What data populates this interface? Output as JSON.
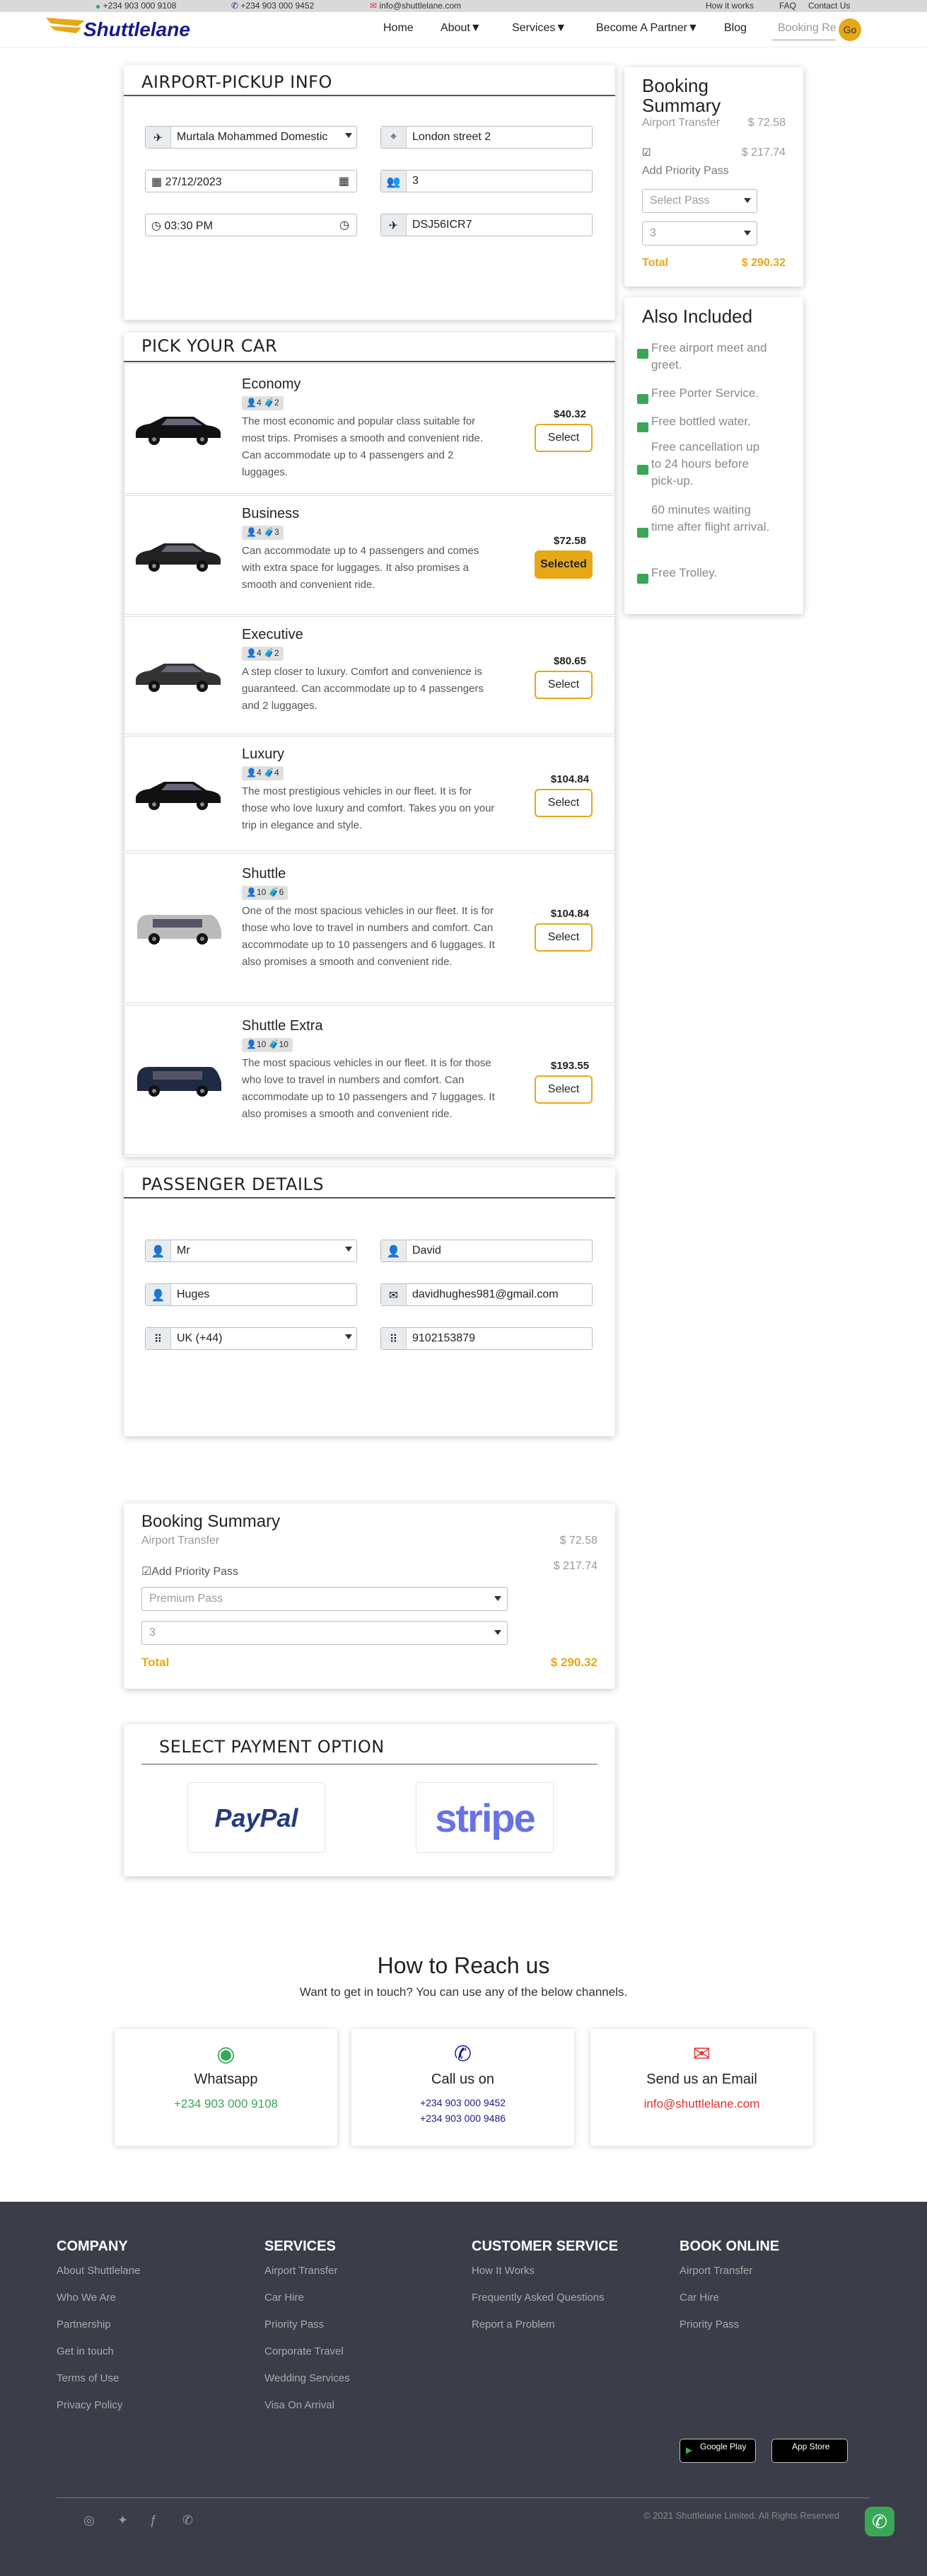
{
  "topbar": {
    "whatsapp": "+234 903 000 9108",
    "phone": "+234 903 000 9452",
    "email": "info@shuttlelane.com",
    "links": [
      "How it works",
      "FAQ",
      "Contact Us"
    ]
  },
  "nav": {
    "logo": "Shuttlelane",
    "items": [
      "Home",
      "About",
      "Services",
      "Become A Partner",
      "Blog"
    ],
    "search_placeholder": "Booking Re",
    "go": "Go"
  },
  "pickup": {
    "title": "AIRPORT-PICKUP INFO",
    "airport": "Murtala Mohammed Domestic",
    "address": "London street 2",
    "date": "27/12/2023",
    "passengers": "3",
    "time": "03:30 PM",
    "flight": "DSJ56ICR7"
  },
  "cars": {
    "title": "PICK YOUR CAR",
    "items": [
      {
        "name": "Economy",
        "pax": "4",
        "lug": "2",
        "desc": "The most economic and popular class suitable for most trips. Promises a smooth and convenient ride. Can accommodate up to 4 passengers and 2 luggages.",
        "price": "$40.32",
        "btn": "Select",
        "selected": false
      },
      {
        "name": "Business",
        "pax": "4",
        "lug": "3",
        "desc": "Can accommodate up to 4 passengers and comes with extra space for luggages. It also promises a smooth and convenient ride.",
        "price": "$72.58",
        "btn": "Selected",
        "selected": true
      },
      {
        "name": "Executive",
        "pax": "4",
        "lug": "2",
        "desc": "A step closer to luxury. Comfort and convenience is guaranteed. Can accommodate up to 4 passengers and 2 luggages.",
        "price": "$80.65",
        "btn": "Select",
        "selected": false
      },
      {
        "name": "Luxury",
        "pax": "4",
        "lug": "4",
        "desc": "The most prestigious vehicles in our fleet. It is for those who love luxury and comfort. Takes you on your trip in elegance and style.",
        "price": "$104.84",
        "btn": "Select",
        "selected": false
      },
      {
        "name": "Shuttle",
        "pax": "10",
        "lug": "6",
        "desc": "One of the most spacious vehicles in our fleet. It is for those who love to travel in numbers and comfort. Can accommodate up to 10 passengers and 6 luggages. It also promises a smooth and convenient ride.",
        "price": "$104.84",
        "btn": "Select",
        "selected": false
      },
      {
        "name": "Shuttle Extra",
        "pax": "10",
        "lug": "10",
        "desc": "The most spacious vehicles in our fleet. It is for those who love to travel in numbers and comfort. Can accommodate up to 10 passengers and 7 luggages. It also promises a smooth and convenient ride.",
        "price": "$193.55",
        "btn": "Select",
        "selected": false
      }
    ]
  },
  "passenger": {
    "title": "PASSENGER DETAILS",
    "titlep": "Mr",
    "first": "David",
    "last": "Huges",
    "email": "davidhughes981@gmail.com",
    "country": "UK (+44)",
    "phone": "9102153879"
  },
  "summary": {
    "title": "Booking Summary",
    "transfer": "Airport Transfer",
    "transfer_price": "$ 72.58",
    "priority": "Add Priority Pass",
    "priority_price": "$ 217.74",
    "pass_placeholder": "Select Pass",
    "pass_value": "Premium Pass",
    "qty": "3",
    "total_label": "Total",
    "total": "$ 290.32"
  },
  "included": {
    "title": "Also Included",
    "items": [
      "Free airport meet and greet.",
      "Free Porter Service.",
      "Free bottled water.",
      "Free cancellation up to 24 hours before pick-up.",
      "60 minutes waiting time after flight arrival.",
      "Free Trolley."
    ]
  },
  "payment": {
    "title": "SELECT PAYMENT OPTION",
    "paypal": "PayPal",
    "stripe": "stripe"
  },
  "reach": {
    "title": "How to Reach us",
    "subtitle": "Want to get in touch? You can use any of the below channels.",
    "whatsapp_title": "Whatsapp",
    "whatsapp_num": "+234 903 000 9108",
    "call_title": "Call us on",
    "call1": "+234 903 000 9452",
    "call2": "+234 903 000 9486",
    "email_title": "Send us an Email",
    "email": "info@shuttlelane.com"
  },
  "footer": {
    "company": {
      "title": "COMPANY",
      "links": [
        "About Shuttlelane",
        "Who We Are",
        "Partnership",
        "Get in touch",
        "Terms of Use",
        "Privacy Policy"
      ]
    },
    "services": {
      "title": "SERVICES",
      "links": [
        "Airport Transfer",
        "Car Hire",
        "Priority Pass",
        "Corporate Travel",
        "Wedding Services",
        "Visa On Arrival"
      ]
    },
    "customer": {
      "title": "CUSTOMER SERVICE",
      "links": [
        "How It Works",
        "Frequently Asked Questions",
        "Report a Problem"
      ]
    },
    "book": {
      "title": "BOOK ONLINE",
      "links": [
        "Airport Transfer",
        "Car Hire",
        "Priority Pass"
      ]
    },
    "googleplay": "Google Play",
    "appstore": "App Store",
    "copyright": "© 2021 Shuttlelane Limited. All Rights Reserved"
  },
  "colors": {
    "accent": "#e6a817",
    "whatsapp": "#3aa657",
    "call": "#1a1a8c",
    "email": "#e03030",
    "footer": "#3b3e48"
  }
}
